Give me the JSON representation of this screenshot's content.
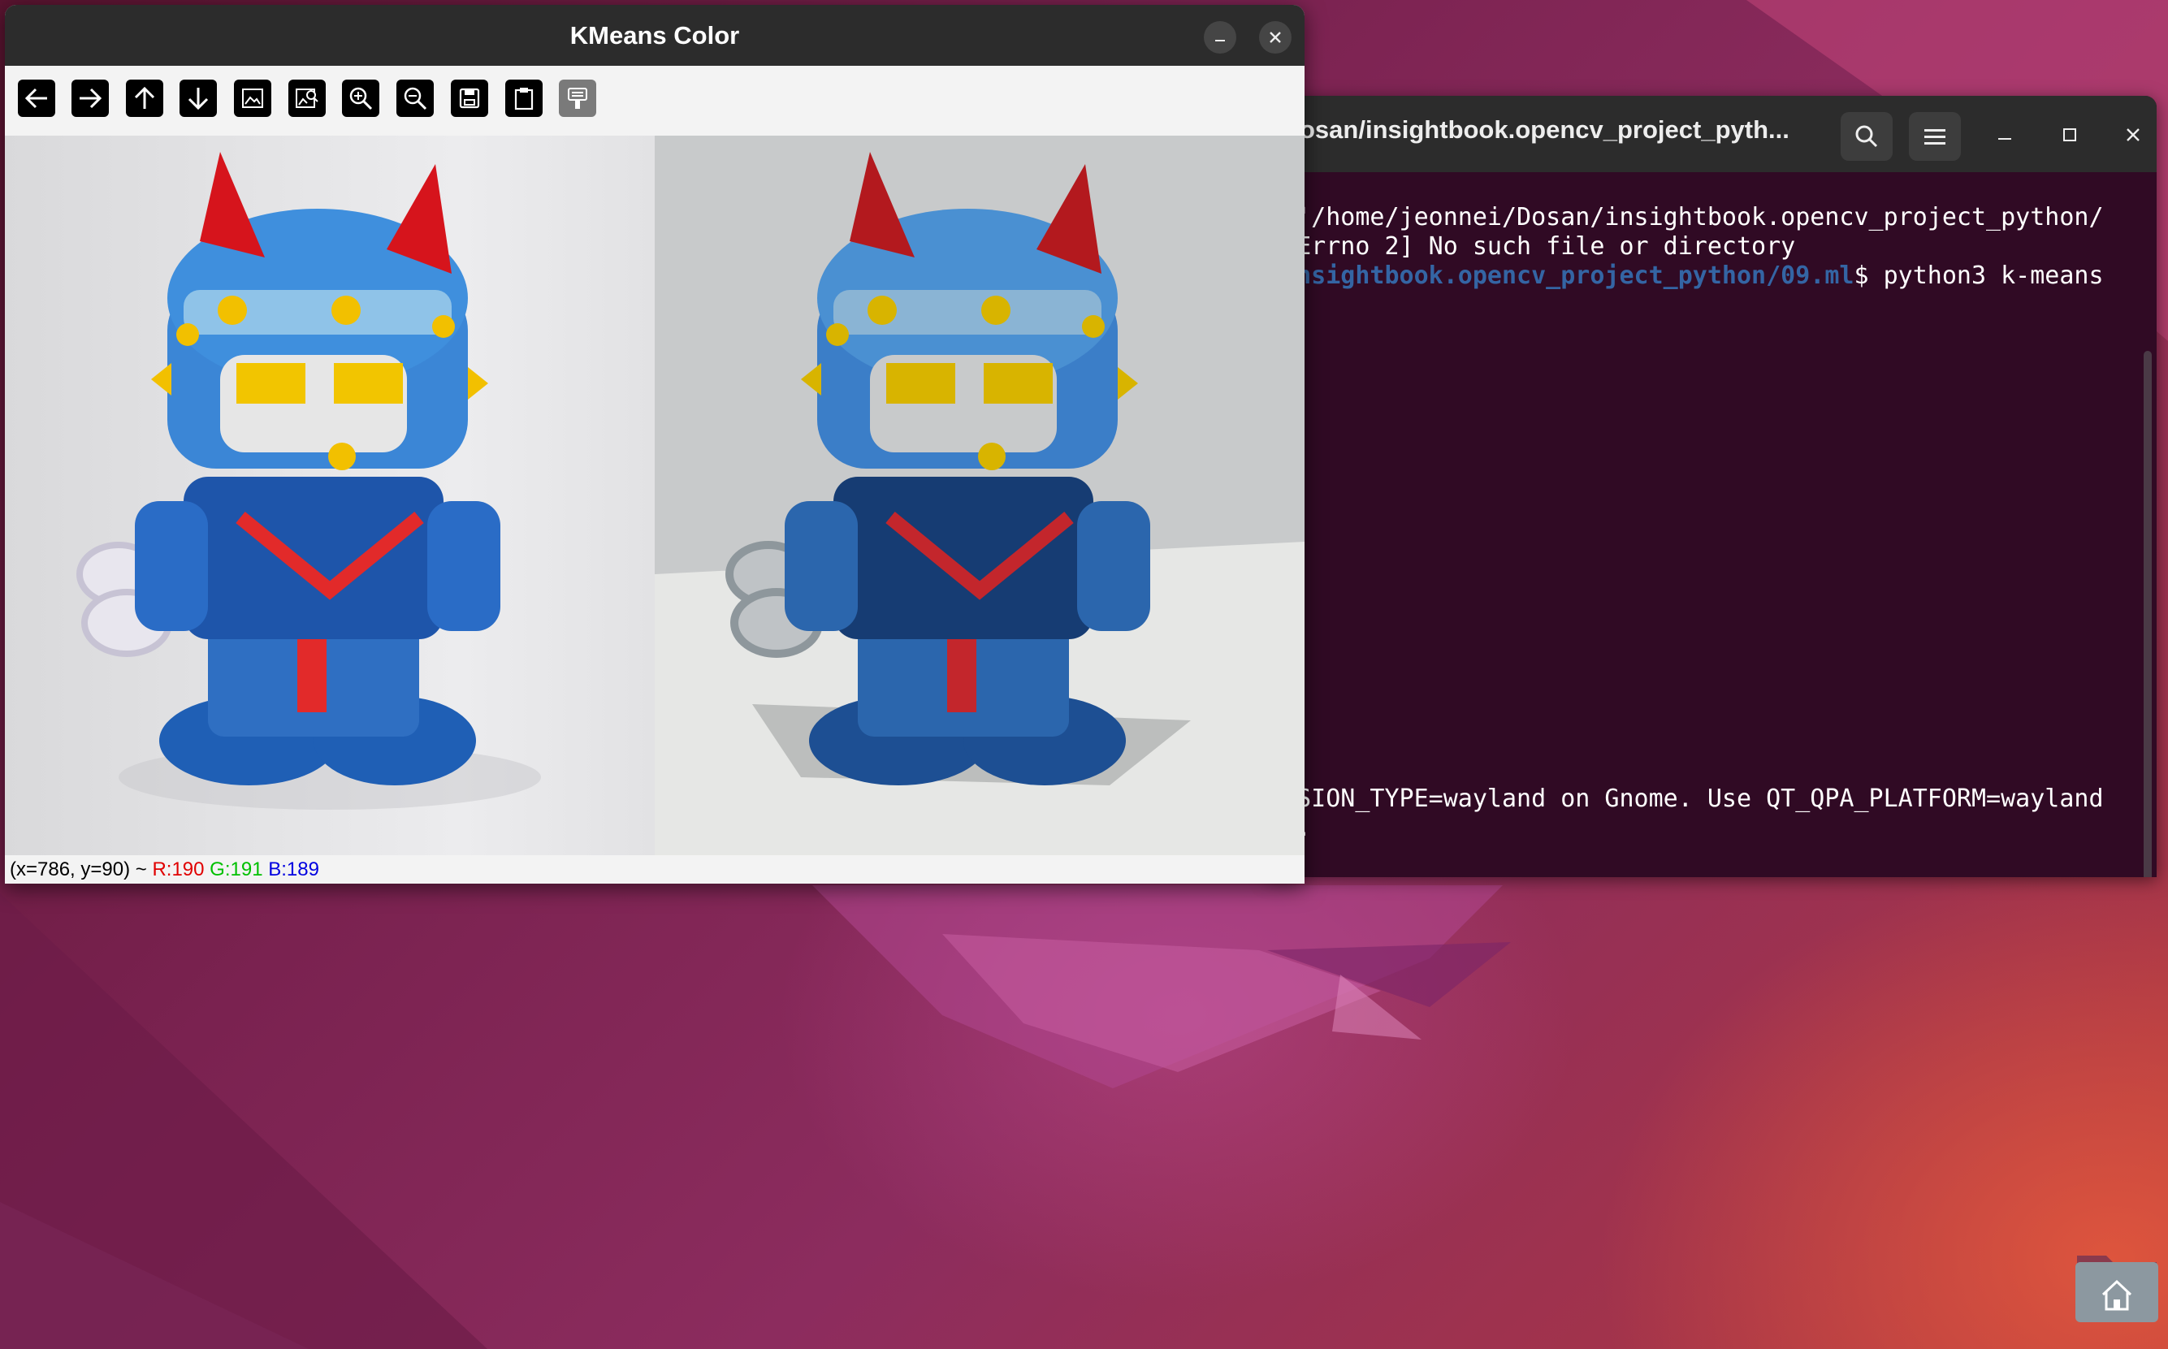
{
  "desktop": {
    "colors": {
      "bg_dark": "#5a1430",
      "bg_mid": "#8c2c5e",
      "bg_warm": "#b0383f"
    }
  },
  "terminal": {
    "title": "osan/insightbook.opencv_project_pyth...",
    "lines": [
      {
        "text": "e '/home/jeonnei/Dosan/insightbook.opencv_project_python/"
      },
      {
        "text": " [Errno 2] No such file or directory"
      },
      {
        "path": "/insightbook.opencv_project_python/09.ml",
        "text": "$ python3 k-means"
      },
      {
        "text": "ESSION_TYPE=wayland on Gnome. Use QT_QPA_PLATFORM=wayland"
      },
      {
        "text": "ay."
      }
    ],
    "icons": [
      "search-icon",
      "hamburger-menu-icon",
      "minimize-icon",
      "maximize-icon",
      "close-icon"
    ]
  },
  "kmeans_window": {
    "title": "KMeans Color",
    "toolbar": [
      "arrow-left-icon",
      "arrow-right-icon",
      "arrow-up-icon",
      "arrow-down-icon",
      "image-icon",
      "image-search-icon",
      "zoom-in-icon",
      "zoom-out-icon",
      "save-icon",
      "clipboard-icon",
      "properties-icon"
    ],
    "status": {
      "coords": "(x=786, y=90) ~ ",
      "r": "R:190",
      "g": "G:191",
      "b": "B:189",
      "colors": {
        "r": "#e00000",
        "g": "#00c000",
        "b": "#0000e0"
      }
    }
  },
  "dock": {
    "home_icon": "home-folder-icon"
  }
}
